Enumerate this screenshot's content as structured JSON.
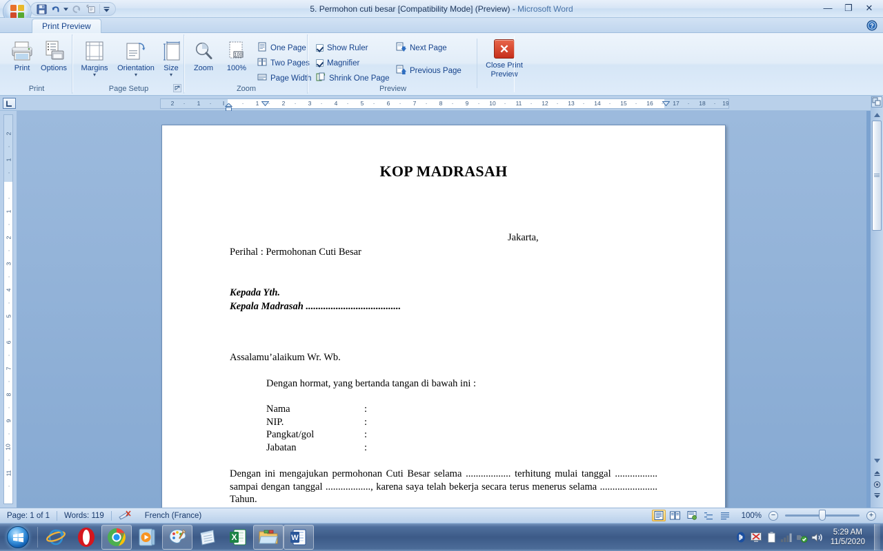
{
  "window": {
    "title": "5. Permohon cuti besar [Compatibility Mode] (Preview)",
    "separator": " - ",
    "app_name": "Microsoft Word",
    "minimize": "—",
    "maximize": "❐",
    "close": "✕"
  },
  "quick_access": {
    "save": "save-icon",
    "undo": "undo-icon",
    "undo_dropdown": "chevron-down-icon",
    "redo": "redo-icon",
    "print_preview": "print-preview-icon",
    "customize": "customize-qat-icon"
  },
  "ribbon": {
    "tab_label": "Print Preview",
    "help": "help-icon",
    "groups": [
      {
        "name": "Print",
        "title": "Print",
        "buttons": [
          {
            "label": "Print",
            "icon": "printer-icon"
          },
          {
            "label": "Options",
            "icon": "options-icon"
          }
        ]
      },
      {
        "name": "Page Setup",
        "title": "Page Setup",
        "buttons": [
          {
            "label": "Margins",
            "icon": "margins-icon",
            "caret": "▾"
          },
          {
            "label": "Orientation",
            "icon": "orientation-icon",
            "caret": "▾"
          },
          {
            "label": "Size",
            "icon": "size-icon",
            "caret": "▾"
          }
        ],
        "dialog_launcher": "dialog-launcher-icon"
      },
      {
        "name": "Zoom",
        "title": "Zoom",
        "buttons": [
          {
            "label": "Zoom",
            "icon": "magnifier-icon"
          },
          {
            "label": "100%",
            "icon": "zoom-100-icon"
          }
        ],
        "small_buttons": [
          {
            "label": "One Page",
            "icon": "one-page-icon"
          },
          {
            "label": "Two Pages",
            "icon": "two-pages-icon"
          },
          {
            "label": "Page Width",
            "icon": "page-width-icon"
          }
        ]
      },
      {
        "name": "Preview",
        "title": "Preview",
        "checkboxes": [
          {
            "label": "Show Ruler",
            "checked": true
          },
          {
            "label": "Magnifier",
            "checked": true
          }
        ],
        "small_buttons": [
          {
            "label": "Shrink One Page",
            "icon": "shrink-one-page-icon"
          },
          {
            "label": "Next Page",
            "icon": "next-page-icon"
          },
          {
            "label": "Previous Page",
            "icon": "previous-page-icon"
          }
        ],
        "close_button": {
          "line1": "Close Print",
          "line2": "Preview",
          "icon": "close-x-icon"
        }
      }
    ]
  },
  "rulers": {
    "corner_tab_icon": "tab-stop-icon",
    "horizontal_ticks": [
      "2",
      "1",
      "1",
      "2",
      "3",
      "4",
      "5",
      "6",
      "7",
      "8",
      "9",
      "10",
      "11",
      "12",
      "13",
      "14",
      "15",
      "16",
      "17",
      "18",
      "19"
    ],
    "vertical_ticks": [
      "2",
      "1",
      "1",
      "2",
      "3",
      "4",
      "5",
      "6",
      "7",
      "8",
      "9",
      "10",
      "11",
      "12"
    ]
  },
  "document": {
    "heading": "KOP MADRASAH",
    "place_date": "Jakarta,",
    "subject": "Perihal : Permohonan Cuti Besar",
    "recipient_line1": "Kepada Yth.",
    "recipient_line2": "Kepala Madrasah ......................................",
    "greeting": "Assalamu’alaikum  Wr. Wb.",
    "intro": "Dengan hormat, yang bertanda tangan di bawah ini :",
    "fields": [
      {
        "label": "Nama",
        "colon": ":",
        "value": ""
      },
      {
        "label": "NIP.",
        "colon": ":",
        "value": ""
      },
      {
        "label": "Pangkat/gol",
        "colon": ":",
        "value": ""
      },
      {
        "label": "Jabatan",
        "colon": ":",
        "value": ""
      }
    ],
    "body_paragraph": "Dengan ini mengajukan permohonan Cuti Besar selama .................. terhitung mulai tanggal ................. sampai dengan tanggal .................., karena saya telah bekerja secara terus menerus selama ....................... Tahun."
  },
  "scrollbar": {
    "select_browse_object": "select-browse-object-icon",
    "scroll_up": "▲",
    "scroll_down": "▼",
    "previous_page": "previous-page-nav-icon",
    "browse_object": "browse-object-nav-icon",
    "next_page": "next-page-nav-icon"
  },
  "statusbar": {
    "page": "Page: 1 of 1",
    "words": "Words: 119",
    "proofing_icon": "proofing-errors-icon",
    "language": "French (France)",
    "views": [
      {
        "name": "print-layout",
        "icon": "print-layout-icon",
        "active": true
      },
      {
        "name": "full-screen-reading",
        "icon": "full-screen-reading-icon",
        "active": false
      },
      {
        "name": "web-layout",
        "icon": "web-layout-icon",
        "active": false
      },
      {
        "name": "outline",
        "icon": "outline-icon",
        "active": false
      },
      {
        "name": "draft",
        "icon": "draft-icon",
        "active": false
      }
    ],
    "zoom_level": "100%",
    "zoom_out": "−",
    "zoom_in": "+"
  },
  "taskbar": {
    "start": "windows-start-icon",
    "items": [
      {
        "name": "internet-explorer",
        "framed": false
      },
      {
        "name": "opera",
        "framed": false
      },
      {
        "name": "google-chrome",
        "framed": true
      },
      {
        "name": "media-player",
        "framed": false
      },
      {
        "name": "paint",
        "framed": true
      },
      {
        "name": "notepad",
        "framed": false
      },
      {
        "name": "excel",
        "framed": false
      },
      {
        "name": "windows-explorer",
        "framed": true
      },
      {
        "name": "microsoft-word",
        "framed": true
      }
    ],
    "tray": [
      {
        "name": "bluetooth-icon"
      },
      {
        "name": "display-disconnected-icon"
      },
      {
        "name": "battery-icon"
      },
      {
        "name": "network-signal-icon"
      },
      {
        "name": "usb-safely-remove-icon"
      },
      {
        "name": "volume-icon"
      }
    ],
    "clock_time": "5:29 AM",
    "clock_date": "11/5/2020"
  }
}
